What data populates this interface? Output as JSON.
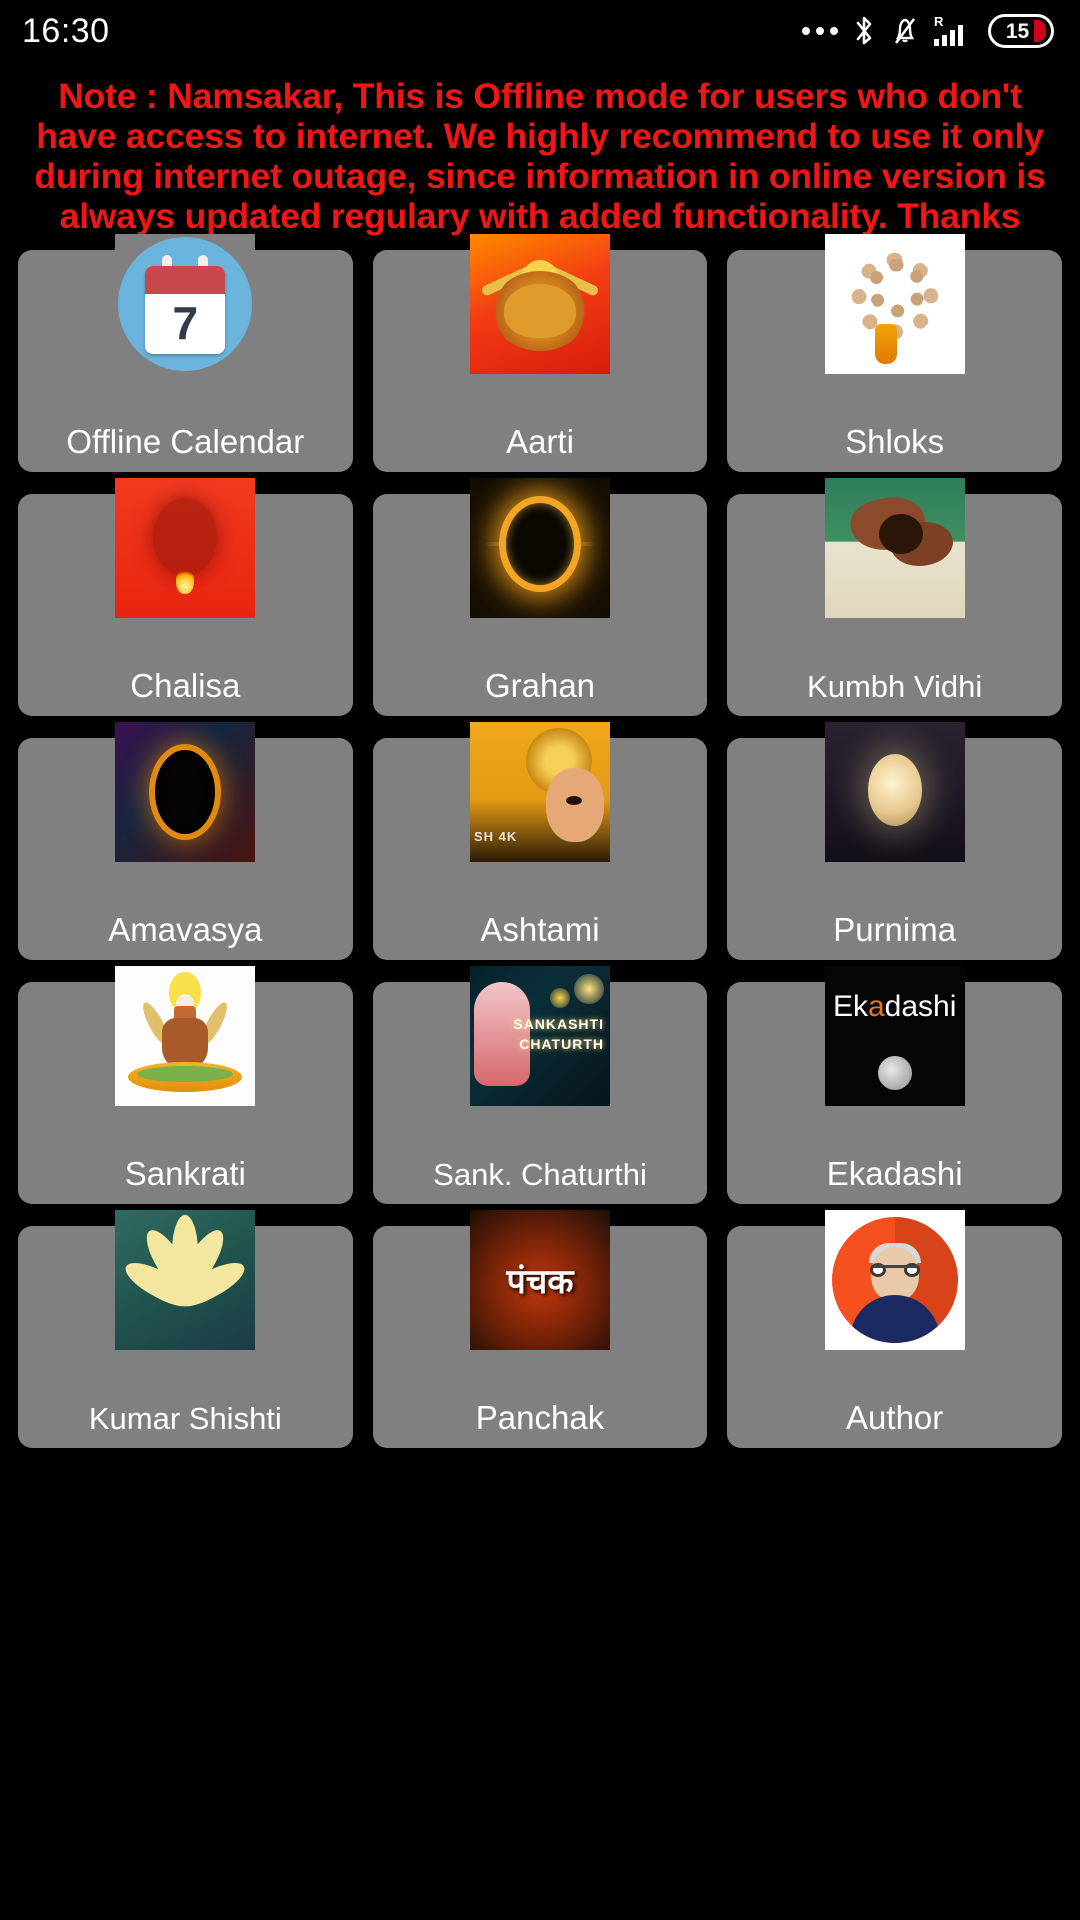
{
  "statusbar": {
    "time": "16:30",
    "icons": [
      {
        "name": "more-dots-icon",
        "glyph": "•••"
      },
      {
        "name": "bluetooth-icon",
        "glyph": "bluetooth"
      },
      {
        "name": "silent-bell-icon",
        "glyph": "bell-muted"
      },
      {
        "name": "roaming-signal-icon",
        "glyph": "R"
      },
      {
        "name": "battery-icon",
        "glyph": "battery"
      }
    ],
    "roaming_label": "R",
    "battery_level": "15"
  },
  "note": {
    "text": "Note : Namsakar, This is Offline mode for users who don't have access to internet. We highly recommend to use it only during internet outage, since information in online version is always updated regulary with added functionality. Thanks",
    "color": "#f01616"
  },
  "theme": {
    "background": "#000000",
    "tile_background": "#808080",
    "tile_label_color": "#ffffff"
  },
  "grid": {
    "tiles": [
      {
        "label": "Offline Calendar",
        "icon": "calendar-icon",
        "day": "7"
      },
      {
        "label": "Aarti",
        "icon": "durga-lion-icon"
      },
      {
        "label": "Shloks",
        "icon": "prayer-beads-icon"
      },
      {
        "label": "Chalisa",
        "icon": "hanuman-icon"
      },
      {
        "label": "Grahan",
        "icon": "solar-eclipse-icon"
      },
      {
        "label": "Kumbh Vidhi",
        "icon": "kumbh-hand-icon"
      },
      {
        "label": "Amavasya",
        "icon": "dark-eclipse-icon"
      },
      {
        "label": "Ashtami",
        "icon": "goddess-icon",
        "overlay_text": "SH 4K"
      },
      {
        "label": "Purnima",
        "icon": "full-moon-icon"
      },
      {
        "label": "Sankrati",
        "icon": "kalash-pot-icon"
      },
      {
        "label": "Sank. Chaturthi",
        "icon": "ganesha-icon",
        "overlay_line1": "SANKASHTI",
        "overlay_line2": "CHATURTH"
      },
      {
        "label": "Ekadashi",
        "icon": "ekadashi-moon-icon",
        "logo_a": "Ek",
        "logo_b": "a",
        "logo_c": "dashi"
      },
      {
        "label": "Kumar Shishti",
        "icon": "leaf-icon"
      },
      {
        "label": "Panchak",
        "icon": "panchak-icon",
        "overlay_text": "पंचक"
      },
      {
        "label": "Author",
        "icon": "author-avatar-icon"
      }
    ]
  }
}
